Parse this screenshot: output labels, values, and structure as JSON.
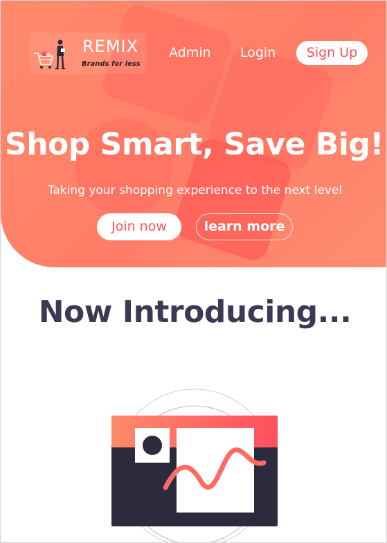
{
  "brand": {
    "name": "REMIX",
    "tagline": "Brands for less"
  },
  "nav": {
    "admin_label": "Admin",
    "login_label": "Login",
    "signup_label": "Sign Up"
  },
  "hero": {
    "title": "Shop Smart, Save Big!",
    "subtitle": "Taking your shopping experience to the next level",
    "join_label": "Join now",
    "learn_label": "learn more"
  },
  "section": {
    "heading": "Now Introducing..."
  },
  "colors": {
    "hero_gradient": "#ff8a6a",
    "accent": "#ff4f5e",
    "heading": "#3a3a55",
    "illustration_dark": "#2c2a3d"
  },
  "icons": {
    "logo": "shopper-with-cart-illustration",
    "feature": "analytics-dashboard-illustration"
  }
}
